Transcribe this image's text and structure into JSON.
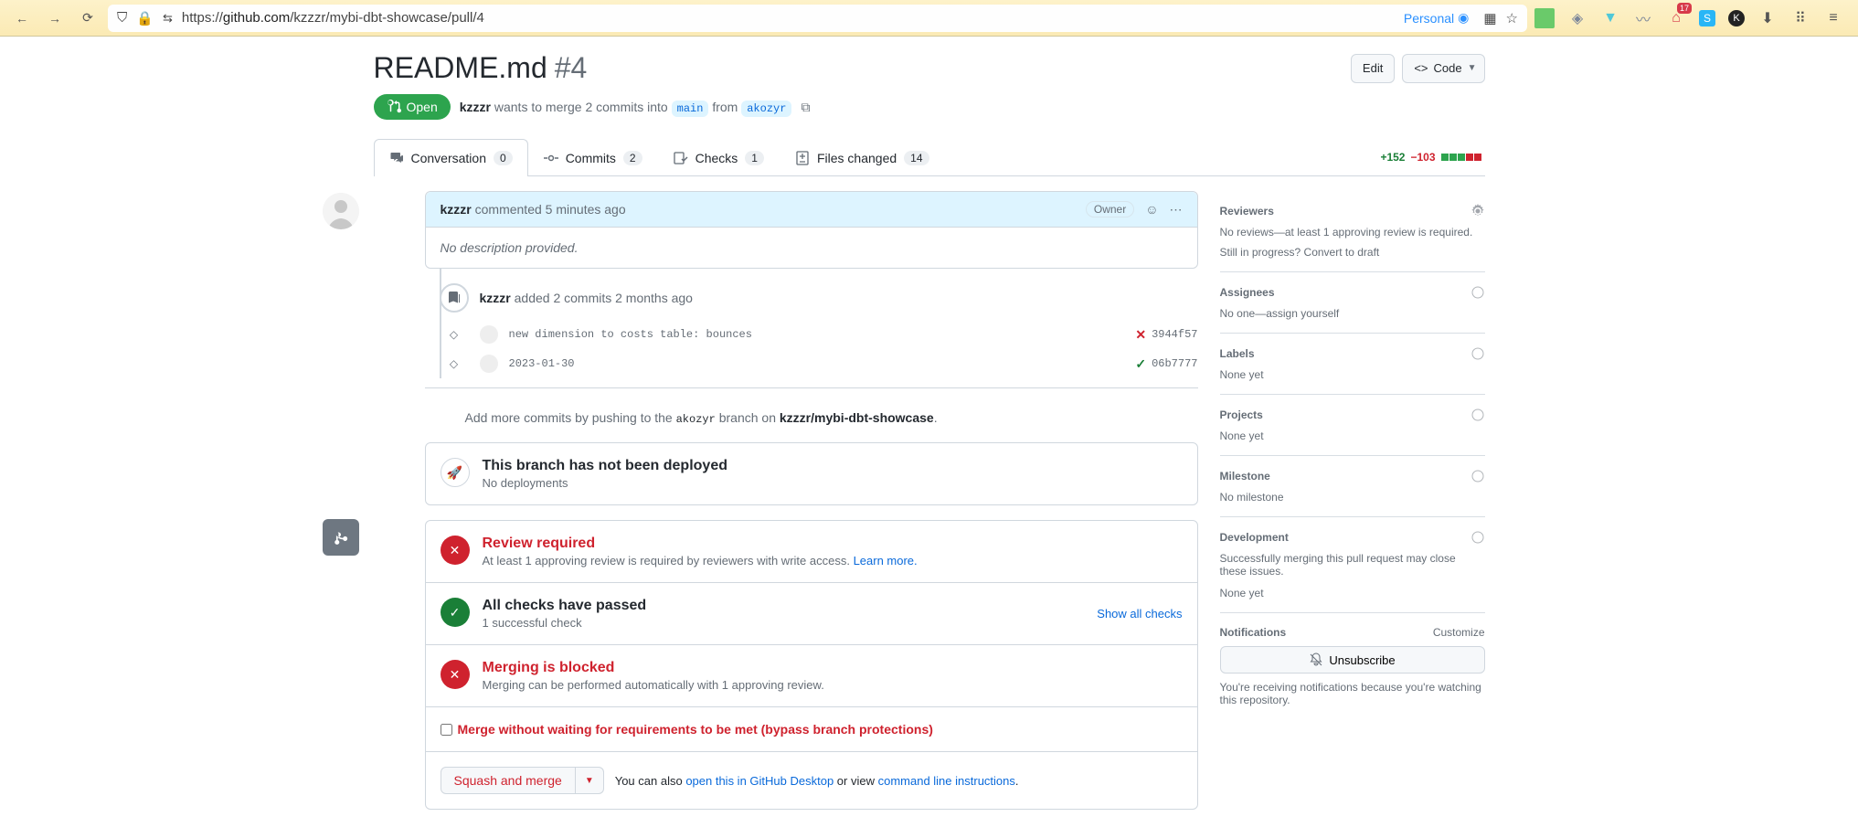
{
  "browser": {
    "url_prefix": "https://",
    "url_domain": "github.com",
    "url_path": "/kzzzr/mybi-dbt-showcase/pull/4",
    "personal": "Personal",
    "ext_badge": "17"
  },
  "pr": {
    "title": "README.md",
    "number": "#4",
    "edit": "Edit",
    "code": "Code",
    "state": "Open",
    "author": "kzzzr",
    "wants": " wants to merge 2 commits into ",
    "base": "main",
    "from": " from ",
    "head": "akozyr"
  },
  "tabs": {
    "conversation": "Conversation",
    "conversation_n": "0",
    "commits": "Commits",
    "commits_n": "2",
    "checks": "Checks",
    "checks_n": "1",
    "files": "Files changed",
    "files_n": "14",
    "additions": "+152",
    "deletions": "−103"
  },
  "comment": {
    "author": "kzzzr",
    "verb": " commented ",
    "when": "5 minutes ago",
    "owner": "Owner",
    "body": "No description provided."
  },
  "event": {
    "author": "kzzzr",
    "text": " added 2 commits ",
    "when": "2 months ago"
  },
  "commits": [
    {
      "msg": "new dimension to costs table: bounces",
      "sha": "3944f57",
      "status": "fail"
    },
    {
      "msg": "2023-01-30",
      "sha": "06b7777",
      "status": "pass"
    }
  ],
  "hint": {
    "pre": "Add more commits by pushing to the ",
    "branch": "akozyr",
    "mid": " branch on ",
    "repo": "kzzzr/mybi-dbt-showcase",
    "end": "."
  },
  "deploy": {
    "title": "This branch has not been deployed",
    "sub": "No deployments"
  },
  "review": {
    "title": "Review required",
    "sub": "At least 1 approving review is required by reviewers with write access. ",
    "learn": "Learn more."
  },
  "checks": {
    "title": "All checks have passed",
    "sub": "1 successful check",
    "show": "Show all checks"
  },
  "blocked": {
    "title": "Merging is blocked",
    "sub": "Merging can be performed automatically with 1 approving review."
  },
  "bypass": "Merge without waiting for requirements to be met (bypass branch protections)",
  "merge": {
    "button": "Squash and merge",
    "alt_pre": "You can also ",
    "alt_desktop": "open this in GitHub Desktop",
    "alt_mid": " or view ",
    "alt_cli": "command line instructions",
    "alt_end": "."
  },
  "sidebar": {
    "reviewers": {
      "h": "Reviewers",
      "body": "No reviews—at least 1 approving review is required.",
      "prog": "Still in progress? ",
      "convert": "Convert to draft"
    },
    "assignees": {
      "h": "Assignees",
      "body_pre": "No one—",
      "assign": "assign yourself"
    },
    "labels": {
      "h": "Labels",
      "body": "None yet"
    },
    "projects": {
      "h": "Projects",
      "body": "None yet"
    },
    "milestone": {
      "h": "Milestone",
      "body": "No milestone"
    },
    "development": {
      "h": "Development",
      "body": "Successfully merging this pull request may close these issues.",
      "none": "None yet"
    },
    "notifications": {
      "h": "Notifications",
      "cust": "Customize",
      "unsub": "Unsubscribe",
      "reason": "You're receiving notifications because you're watching this repository."
    }
  }
}
